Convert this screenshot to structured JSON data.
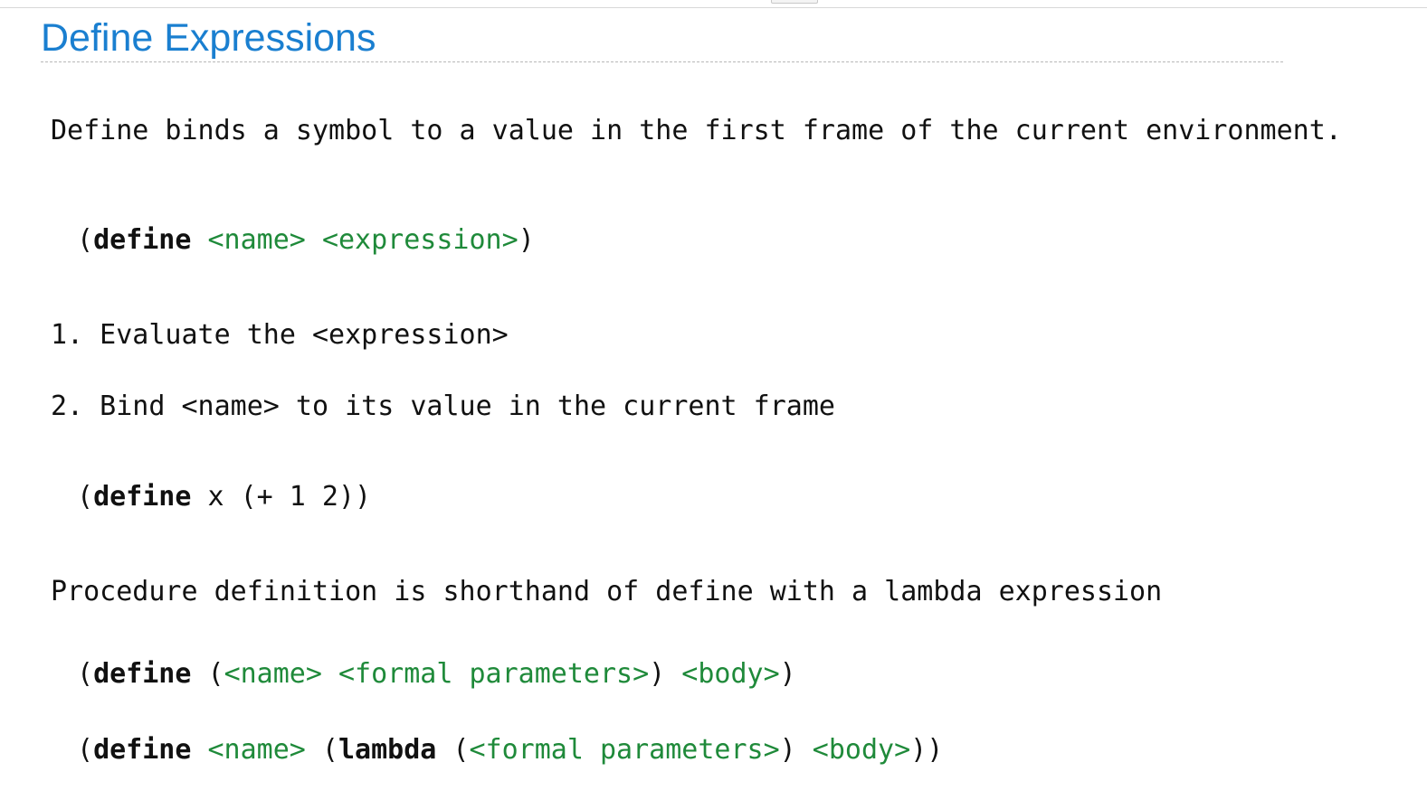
{
  "title": "Define Expressions",
  "intro": "Define binds a symbol to a value in the first frame of the current environment.",
  "syntax": {
    "open": "(",
    "define": "define",
    "name": "<name>",
    "expression": "<expression>",
    "close": ")"
  },
  "steps": [
    "1. Evaluate the <expression>",
    "2. Bind <name> to its value in the current frame"
  ],
  "example": {
    "open": "(",
    "define": "define",
    "rest": " x (+ 1 2))"
  },
  "procedure_note": "Procedure definition is shorthand of define with a lambda expression",
  "proc_syntax": {
    "open": "(",
    "define": "define",
    "paren": " (",
    "name": "<name>",
    "formals": "<formal parameters>",
    "mid": ") ",
    "body": "<body>",
    "close": ")"
  },
  "lambda_syntax": {
    "open": "(",
    "define": "define",
    "name": "<name>",
    "paren": " (",
    "lambda": "lambda",
    "paren2": " (",
    "formals": "<formal parameters>",
    "mid": ") ",
    "body": "<body>",
    "close": "))"
  },
  "colors": {
    "title": "#1a7fd0",
    "placeholder": "#1f8a3a",
    "text": "#111111"
  }
}
